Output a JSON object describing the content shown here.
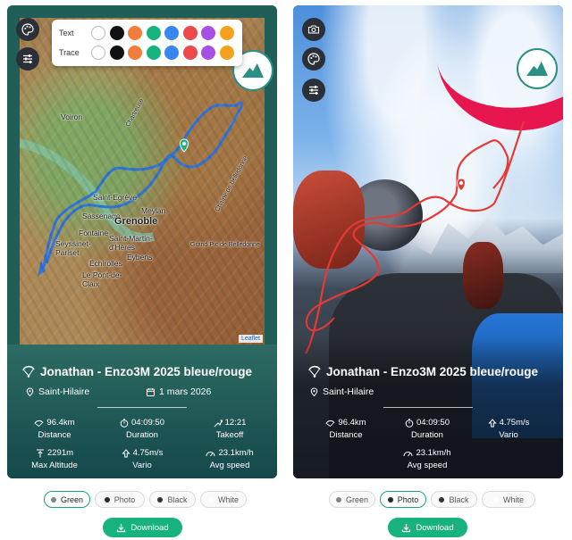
{
  "palette": {
    "text_label": "Text",
    "trace_label": "Trace",
    "swatches": [
      "#ffffff",
      "#111111",
      "#f47c3c",
      "#18b37e",
      "#3a86f0",
      "#ea4a4a",
      "#a84fe6",
      "#f4a21e"
    ]
  },
  "flight": {
    "title": "Jonathan - Enzo3M 2025 bleue/rouge",
    "location": "Saint-Hilaire",
    "date": "1 mars 2026",
    "distance": "96.4km",
    "duration": "04:09:50",
    "takeoff": "12:21",
    "max_altitude": "2291m",
    "vario": "4.75m/s",
    "avg_speed": "23.1km/h"
  },
  "labels": {
    "distance": "Distance",
    "duration": "Duration",
    "takeoff": "Takeoff",
    "max_altitude": "Max Altitude",
    "vario": "Vario",
    "avg_speed": "Avg speed"
  },
  "map": {
    "places": [
      "Voiron",
      "Saint-Egrève",
      "Sassenage",
      "Meylan",
      "Grenoble",
      "Fontaine",
      "Seyssinet-Pariset",
      "Saint-Martin-d'Hères",
      "Eybens",
      "Échirolles",
      "Le Pont-de-Claix",
      "Grand Pic de Belledonne",
      "Chartreuse",
      "Chaîne de Belledonne"
    ],
    "attribution": "Leaflet"
  },
  "style_options": [
    "Green",
    "Photo",
    "Black",
    "White"
  ],
  "style_dots": [
    "#7a8a84",
    "#2a2a2a",
    "#333333",
    "#ffffff"
  ],
  "left_selected_style": "Green",
  "right_selected_style": "Photo",
  "download_label": "Download",
  "colors": {
    "accent": "#18b27f",
    "trace_blue": "#3b78d8",
    "trace_red": "#e53935",
    "green_card": "#1f5f58"
  }
}
